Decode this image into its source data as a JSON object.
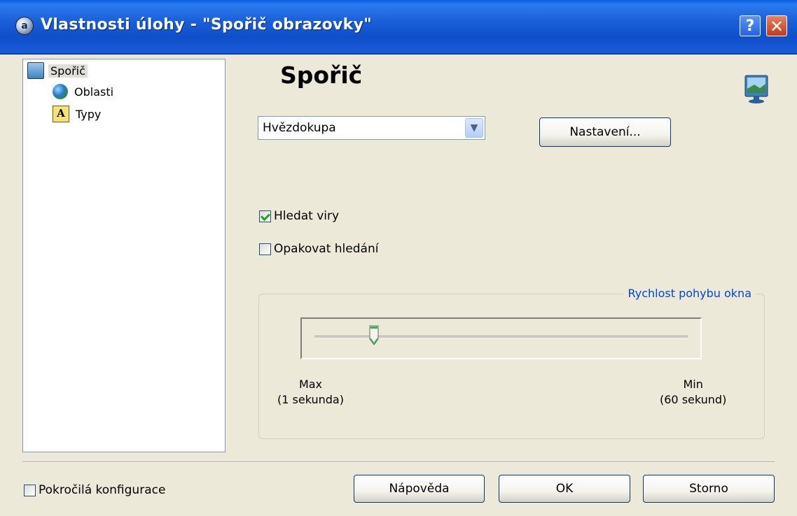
{
  "window": {
    "title": "Vlastnosti úlohy - \"Spořič obrazovky\"",
    "help_label": "?",
    "close_label": "✕",
    "icon_glyph": "a"
  },
  "tree": {
    "items": [
      {
        "label": "Spořič",
        "icon": "monitor-icon",
        "selected": true
      },
      {
        "label": "Oblasti",
        "icon": "globe-icon",
        "selected": false
      },
      {
        "label": "Typy",
        "icon": "font-icon",
        "selected": false
      }
    ],
    "font_icon_glyph": "A"
  },
  "page": {
    "heading": "Spořič",
    "screensaver_select": "Hvězdokupa",
    "settings_button": "Nastavení...",
    "scan_viruses_label": "Hledat viry",
    "scan_viruses_checked": true,
    "repeat_scan_label": "Opakovat hledání",
    "repeat_scan_checked": false
  },
  "speed": {
    "legend": "Rychlost pohybu okna",
    "min_label_line1": "Max",
    "min_label_line2": "(1 sekunda)",
    "max_label_line1": "Min",
    "max_label_line2": "(60 sekund)",
    "slider_fraction": 0.16
  },
  "footer": {
    "advanced_label": "Pokročilá konfigurace",
    "advanced_checked": false,
    "help_button": "Nápověda",
    "ok_button": "OK",
    "cancel_button": "Storno"
  },
  "colors": {
    "titlebar": "#1a5fd8",
    "legend_text": "#0046d5",
    "check_mark": "#21a121"
  }
}
